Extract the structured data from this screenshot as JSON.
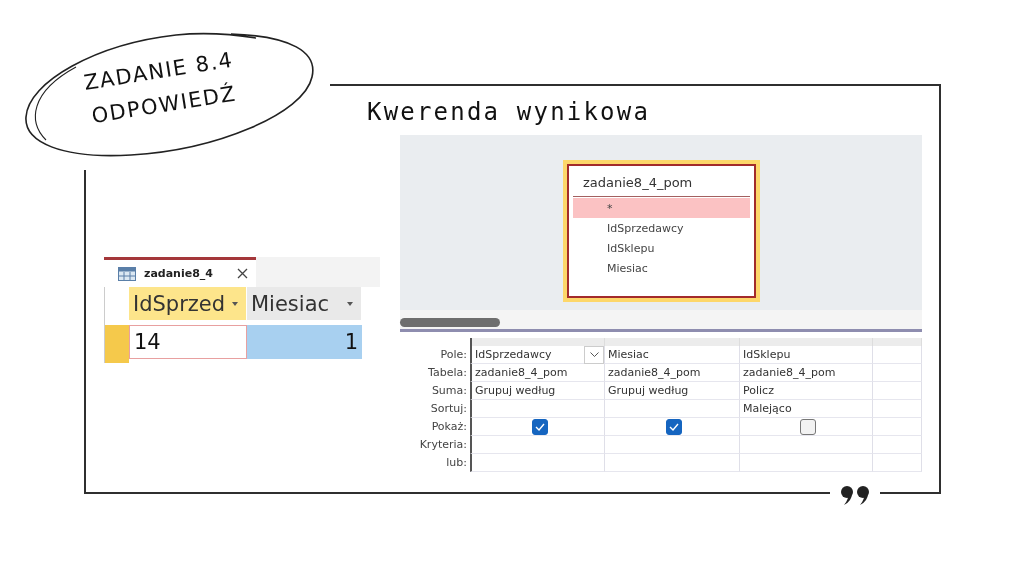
{
  "badge": {
    "lines": [
      "ZADANIE 8.4",
      "ODPOWIEDŹ"
    ]
  },
  "title": "Kwerenda wynikowa",
  "datasheet": {
    "tab": "zadanie8_4",
    "columns": [
      {
        "label": "IdSprzed",
        "selected": true
      },
      {
        "label": "Miesiac",
        "selected": false
      }
    ],
    "rows": [
      [
        {
          "text": "14",
          "kind": "active"
        },
        {
          "text": "1",
          "kind": "highlighted"
        }
      ]
    ]
  },
  "designer": {
    "table": {
      "title": "zadanie8_4_pom",
      "fields": [
        {
          "name": "*",
          "selected": true
        },
        {
          "name": "IdSprzedawcy",
          "selected": false
        },
        {
          "name": "IdSklepu",
          "selected": false
        },
        {
          "name": "Miesiac",
          "selected": false
        }
      ]
    },
    "grid": {
      "row_labels": [
        "Pole:",
        "Tabela:",
        "Suma:",
        "Sortuj:",
        "Pokaż:",
        "Kryteria:",
        "lub:"
      ],
      "columns": [
        {
          "field": "IdSprzedawcy",
          "dropdown": true,
          "table": "zadanie8_4_pom",
          "total": "Grupuj według",
          "show": true
        },
        {
          "field": "Miesiac",
          "dropdown": false,
          "table": "zadanie8_4_pom",
          "total": "Grupuj według",
          "show": true
        },
        {
          "field": "IdSklepu",
          "dropdown": false,
          "table": "zadanie8_4_pom",
          "total": "Policz",
          "sort": "Malejąco",
          "show": false
        }
      ]
    }
  }
}
